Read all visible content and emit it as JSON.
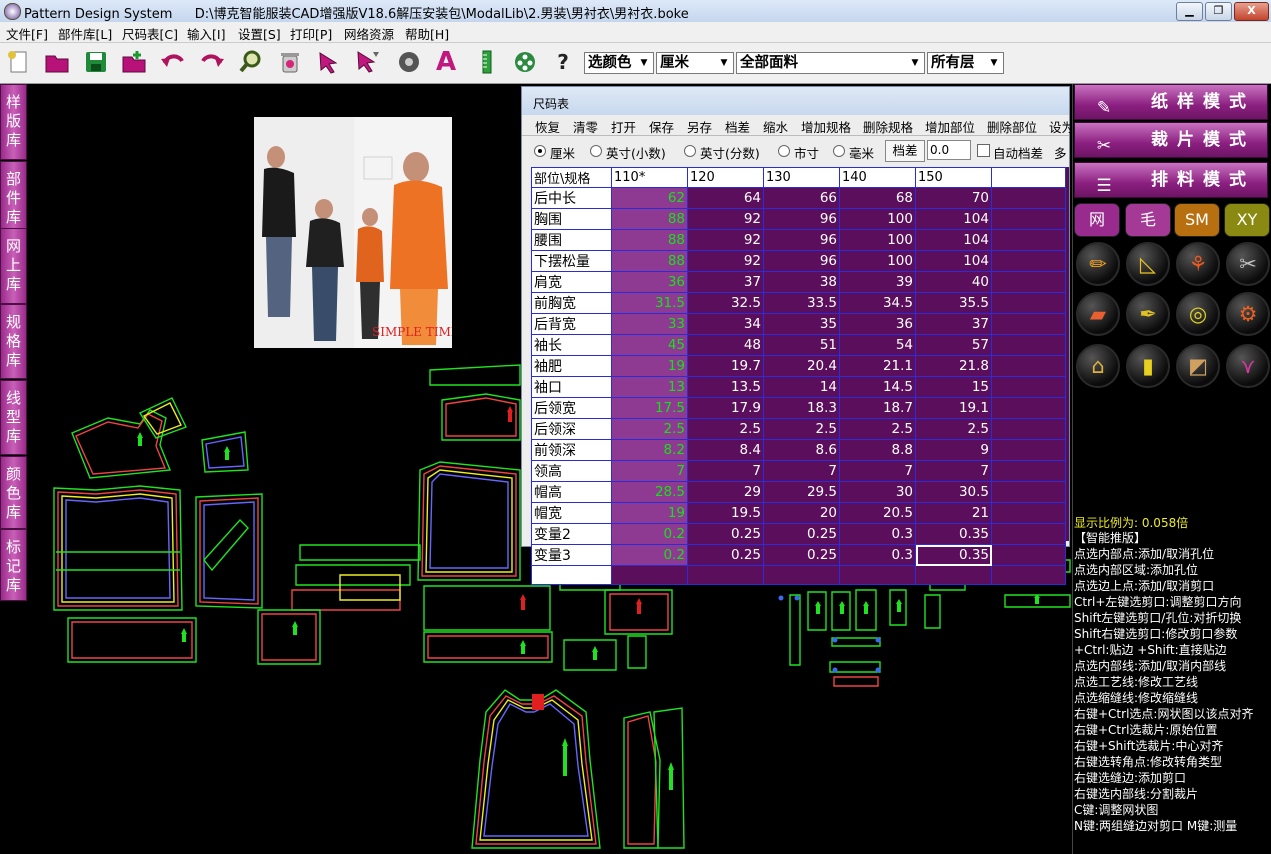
{
  "window": {
    "app_name": "Pattern Design System",
    "file_path": "D:\\博克智能服装CAD增强版V18.6解压安装包\\ModalLib\\2.男装\\男衬衣\\男衬衣.boke",
    "min_btn": "▁",
    "max_btn": "❐",
    "close_btn": "X"
  },
  "menu": [
    "文件[F]",
    "部件库[L]",
    "尺码表[C]",
    "输入[I]",
    "设置[S]",
    "打印[P]",
    "网络资源",
    "帮助[H]"
  ],
  "toolbar": {
    "icons": [
      "new-file-icon",
      "open-folder-icon",
      "save-icon",
      "save-as-folder-icon",
      "undo-icon",
      "redo-icon",
      "zoom-icon",
      "delete-icon",
      "select-arrow-icon",
      "select-arrow-2-icon",
      "measure-icon",
      "text-icon",
      "ruler-icon",
      "film-reel-icon",
      "help-icon"
    ],
    "help_glyph": "?",
    "text_glyph": "A",
    "color_combo": "选颜色",
    "unit_combo": "厘米",
    "fabric_combo": "全部面料",
    "layer_combo": "所有层"
  },
  "left_tabs": [
    "样版库",
    "部件库",
    "网上库",
    "规格库",
    "线型库",
    "颜色库",
    "标记库"
  ],
  "photo": {
    "caption": "SIMPLE TIMES"
  },
  "size_dialog": {
    "title": "尺码表",
    "menu": [
      "恢复",
      "清零",
      "打开",
      "保存",
      "另存",
      "档差",
      "缩水",
      "增加规格",
      "删除规格",
      "增加部位",
      "删除部位",
      "设为"
    ],
    "units": [
      {
        "label": "厘米",
        "selected": true
      },
      {
        "label": "英寸(小数)",
        "selected": false
      },
      {
        "label": "英寸(分数)",
        "selected": false
      },
      {
        "label": "市寸",
        "selected": false
      },
      {
        "label": "毫米",
        "selected": false
      }
    ],
    "grade_button": "档差",
    "grade_value": "0.0",
    "auto_grade_label": "自动档差",
    "more_label": "多",
    "corner_header": "部位\\规格",
    "sizes": [
      "110*",
      "120",
      "130",
      "140",
      "150"
    ],
    "rows": [
      {
        "name": "后中长",
        "values": [
          "62",
          "64",
          "66",
          "68",
          "70"
        ]
      },
      {
        "name": "胸围",
        "values": [
          "88",
          "92",
          "96",
          "100",
          "104"
        ]
      },
      {
        "name": "腰围",
        "values": [
          "88",
          "92",
          "96",
          "100",
          "104"
        ]
      },
      {
        "name": "下摆松量",
        "values": [
          "88",
          "92",
          "96",
          "100",
          "104"
        ]
      },
      {
        "name": "肩宽",
        "values": [
          "36",
          "37",
          "38",
          "39",
          "40"
        ]
      },
      {
        "name": "前胸宽",
        "values": [
          "31.5",
          "32.5",
          "33.5",
          "34.5",
          "35.5"
        ]
      },
      {
        "name": "后背宽",
        "values": [
          "33",
          "34",
          "35",
          "36",
          "37"
        ]
      },
      {
        "name": "袖长",
        "values": [
          "45",
          "48",
          "51",
          "54",
          "57"
        ]
      },
      {
        "name": "袖肥",
        "values": [
          "19",
          "19.7",
          "20.4",
          "21.1",
          "21.8"
        ]
      },
      {
        "name": "袖口",
        "values": [
          "13",
          "13.5",
          "14",
          "14.5",
          "15"
        ]
      },
      {
        "name": "后领宽",
        "values": [
          "17.5",
          "17.9",
          "18.3",
          "18.7",
          "19.1"
        ]
      },
      {
        "name": "后领深",
        "values": [
          "2.5",
          "2.5",
          "2.5",
          "2.5",
          "2.5"
        ]
      },
      {
        "name": "前领深",
        "values": [
          "8.2",
          "8.4",
          "8.6",
          "8.8",
          "9"
        ]
      },
      {
        "name": "领高",
        "values": [
          "7",
          "7",
          "7",
          "7",
          "7"
        ]
      },
      {
        "name": "帽高",
        "values": [
          "28.5",
          "29",
          "29.5",
          "30",
          "30.5"
        ]
      },
      {
        "name": "帽宽",
        "values": [
          "19",
          "19.5",
          "20",
          "20.5",
          "21"
        ]
      },
      {
        "name": "变量2",
        "values": [
          "0.2",
          "0.25",
          "0.25",
          "0.3",
          "0.35"
        ]
      },
      {
        "name": "变量3",
        "values": [
          "0.2",
          "0.25",
          "0.25",
          "0.3",
          "0.35"
        ]
      }
    ]
  },
  "right_panel": {
    "modes": [
      {
        "label": "纸样模式",
        "icon": "pattern-iron-icon"
      },
      {
        "label": "裁片模式",
        "icon": "scissors-icon"
      },
      {
        "label": "排料模式",
        "icon": "marker-layout-icon"
      }
    ],
    "pills": [
      {
        "label": "网",
        "color": "#9a2b8e"
      },
      {
        "label": "毛",
        "color": "#a43a96"
      },
      {
        "label": "SM",
        "color": "#b86f0f"
      },
      {
        "label": "XY",
        "color": "#8a8a12"
      }
    ],
    "tools": [
      "pencil-icon",
      "set-square-icon",
      "figure-tool-icon",
      "scissors-icon",
      "notebook-icon",
      "brush-icon",
      "tape-icon",
      "sewing-machine-icon",
      "iron-icon",
      "fabric-roll-icon",
      "ruler-board-icon",
      "rainbow-icon"
    ],
    "scale_text": "显示比例为: 0.058倍",
    "help_lines": [
      "      【智能推版】",
      "点选内部点:添加/取消孔位",
      "点选内部区域:添加孔位",
      "点选边上点:添加/取消剪口",
      "Ctrl+左键选剪口:调整剪口方向",
      "Shift左键选剪口/孔位:对折切换",
      "Shift右键选剪口:修改剪口参数",
      "  +Ctrl:贴边 +Shift:直接贴边",
      "点选内部线:添加/取消内部线",
      "点选工艺线:修改工艺线",
      "点选缩缝线:修改缩缝线",
      "右键+Ctrl选点:网状图以该点对齐",
      "右键+Ctrl选裁片:原始位置",
      "右键+Shift选裁片:中心对齐",
      "右键选转角点:修改转角类型",
      "右键选缝边:添加剪口",
      "右键选内部线:分割裁片",
      "C键:调整网状图",
      "N键:两组缝边对剪口  M键:测量"
    ]
  }
}
